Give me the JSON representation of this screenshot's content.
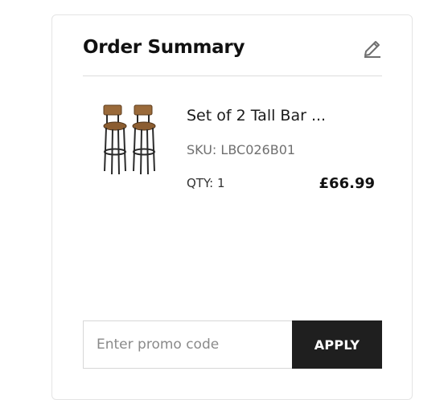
{
  "order_summary": {
    "title": "Order Summary",
    "edit_icon": "pencil-icon"
  },
  "item": {
    "image_icon": "bar-stools-product-image",
    "name": "Set of 2 Tall Bar ...",
    "sku": "SKU: LBC026B01",
    "qty": "QTY: 1",
    "price": "£66.99"
  },
  "promo": {
    "placeholder": "Enter promo code",
    "value": "",
    "apply_label": "APPLY"
  },
  "colors": {
    "apply_button_bg": "#1f1f1f",
    "wood": "#9a6a3a",
    "metal": "#2b2b2b"
  }
}
